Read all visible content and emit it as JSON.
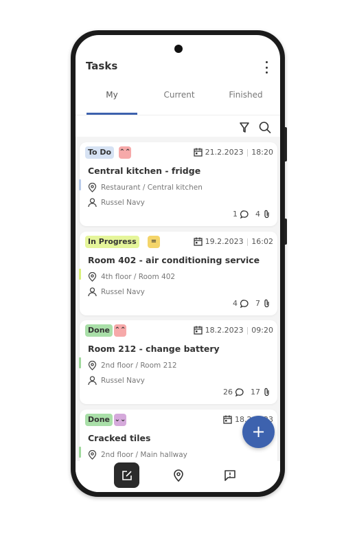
{
  "header": {
    "title": "Tasks"
  },
  "tabs": [
    {
      "label": "My",
      "active": true
    },
    {
      "label": "Current"
    },
    {
      "label": "Finished"
    }
  ],
  "colors": {
    "accent": "#3d62ae",
    "todo": "#d6e2f3",
    "in_progress": "#e5f59a",
    "done": "#a9dfa8",
    "prio_high": "#f6a9a9",
    "prio_medium": "#f4d56a",
    "prio_low": "#d5a9db"
  },
  "tasks": [
    {
      "status": "To Do",
      "priority": "high",
      "title": "Central kitchen - fridge",
      "date": "21.2.2023",
      "time": "18:20",
      "location": "Restaurant / Central kitchen",
      "assignee": "Russel Navy",
      "comments": "1",
      "attachments": "4"
    },
    {
      "status": "In Progress",
      "priority": "medium",
      "title": "Room 402 - air conditioning service",
      "date": "19.2.2023",
      "time": "16:02",
      "location": "4th floor / Room 402",
      "assignee": "Russel Navy",
      "comments": "4",
      "attachments": "7"
    },
    {
      "status": "Done",
      "priority": "high",
      "title": "Room 212 - change battery",
      "date": "18.2.2023",
      "time": "09:20",
      "location": "2nd floor / Room 212",
      "assignee": "Russel Navy",
      "comments": "26",
      "attachments": "17"
    },
    {
      "status": "Done",
      "priority": "low",
      "title": "Cracked tiles",
      "date": "18.2.2023",
      "time": "",
      "location": "2nd floor / Main hallway",
      "assignee": "",
      "comments": "",
      "attachments": ""
    }
  ],
  "fab": {
    "label": "+"
  },
  "nav": [
    {
      "icon": "edit-icon",
      "active": true
    },
    {
      "icon": "location-icon"
    },
    {
      "icon": "report-icon"
    }
  ]
}
